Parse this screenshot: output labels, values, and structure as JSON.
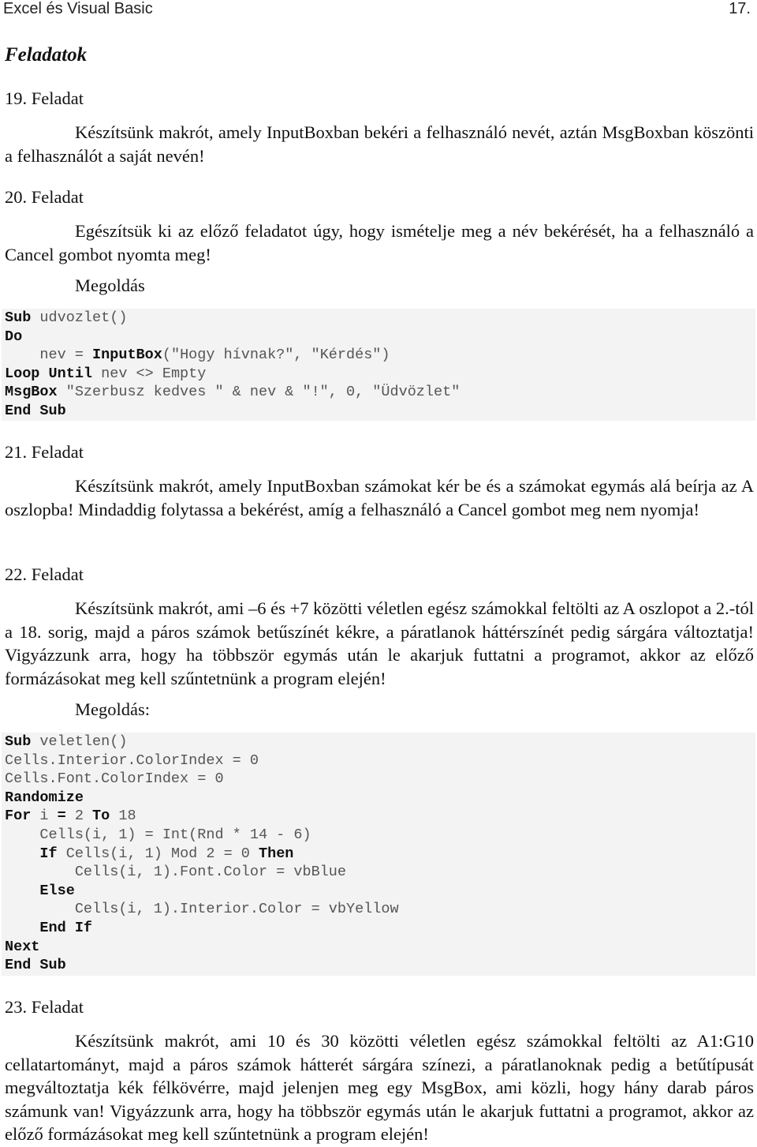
{
  "header": {
    "title": "Excel és Visual Basic",
    "page_number": "17."
  },
  "section_title": "Feladatok",
  "tasks": [
    {
      "heading": "19. Feladat",
      "text": "Készítsünk makrót, amely InputBoxban bekéri a felhasználó nevét, aztán MsgBoxban köszönti a felhasználót a saját nevén!"
    },
    {
      "heading": "20. Feladat",
      "text": "Egészítsük ki az előző feladatot úgy, hogy ismételje meg a név bekérését, ha a felhasználó a Cancel gombot nyomta meg!",
      "solution_label": "Megoldás",
      "code": [
        [
          {
            "k": "Sub"
          },
          {
            "t": " udvozlet()"
          }
        ],
        [
          {
            "k": "Do"
          }
        ],
        [
          {
            "t": "    nev = "
          },
          {
            "k": "InputBox"
          },
          {
            "t": "(\"Hogy hívnak?\", \"Kérdés\")"
          }
        ],
        [
          {
            "k": "Loop Until"
          },
          {
            "t": " nev <> Empty"
          }
        ],
        [
          {
            "k": "MsgBox"
          },
          {
            "t": " \"Szerbusz kedves \" & nev & \"!\", 0, \"Üdvözlet\""
          }
        ],
        [
          {
            "k": "End Sub"
          }
        ]
      ]
    },
    {
      "heading": "21. Feladat",
      "text": "Készítsünk makrót, amely InputBoxban számokat kér be és a számokat egymás alá beírja az A oszlopba! Mindaddig folytassa a bekérést, amíg a felhasználó a Cancel gombot meg nem nyomja!"
    },
    {
      "heading": "22. Feladat",
      "text": "Készítsünk makrót, ami –6 és +7 közötti véletlen egész számokkal feltölti az A oszlopot a 2.-tól a 18. sorig, majd a páros számok betűszínét kékre, a páratlanok háttérszínét pedig sárgára változtatja! Vigyázzunk arra, hogy ha többször egymás után le akarjuk futtatni a programot, akkor az előző formázásokat meg kell szűntetnünk a program elején!",
      "solution_label": "Megoldás:",
      "code": [
        [
          {
            "k": "Sub"
          },
          {
            "t": " veletlen()"
          }
        ],
        [
          {
            "t": "Cells.Interior.ColorIndex = 0"
          }
        ],
        [
          {
            "t": "Cells.Font.ColorIndex = 0"
          }
        ],
        [
          {
            "k": "Randomize"
          }
        ],
        [
          {
            "k": "For"
          },
          {
            "t": " i "
          },
          {
            "k": "="
          },
          {
            "t": " 2 "
          },
          {
            "k": "To"
          },
          {
            "t": " 18"
          }
        ],
        [
          {
            "t": "    Cells(i, 1) = Int(Rnd * 14 - 6)"
          }
        ],
        [
          {
            "t": "    "
          },
          {
            "k": "If"
          },
          {
            "t": " Cells(i, 1) Mod 2 = 0 "
          },
          {
            "k": "Then"
          }
        ],
        [
          {
            "t": "        Cells(i, 1).Font.Color = vbBlue"
          }
        ],
        [
          {
            "t": "    "
          },
          {
            "k": "Else"
          }
        ],
        [
          {
            "t": "        Cells(i, 1).Interior.Color = vbYellow"
          }
        ],
        [
          {
            "t": "    "
          },
          {
            "k": "End If"
          }
        ],
        [
          {
            "k": "Next"
          }
        ],
        [
          {
            "k": "End Sub"
          }
        ]
      ]
    },
    {
      "heading": "23. Feladat",
      "text": "Készítsünk makrót, ami 10 és 30 közötti véletlen egész számokkal feltölti az A1:G10 cellatartományt, majd a páros számok hátterét sárgára színezi, a páratlanoknak pedig a betűtípusát megváltoztatja kék félkövérre, majd jelenjen meg egy MsgBox, ami közli, hogy hány darab páros számunk van! Vigyázzunk arra, hogy ha többször egymás után le akarjuk futtatni a programot, akkor az előző formázásokat meg kell szűntetnünk a program elején!"
    }
  ],
  "colors": {
    "code_background": "#f3f3f3",
    "code_text": "#555555",
    "code_keyword": "#111111",
    "body_text": "#111111"
  }
}
